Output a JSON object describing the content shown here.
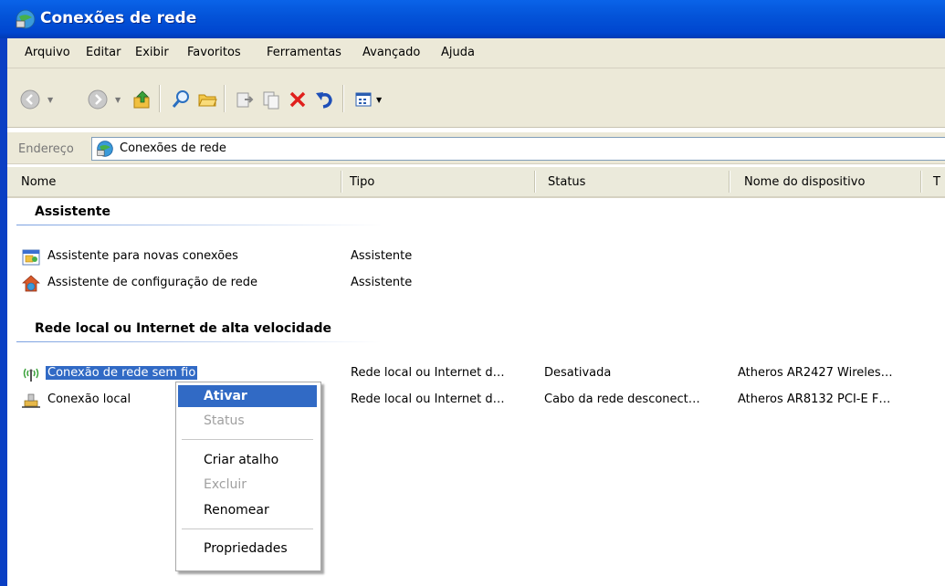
{
  "window": {
    "title": "Conexões de rede"
  },
  "menu": [
    "Arquivo",
    "Editar",
    "Exibir",
    "Favoritos",
    "Ferramentas",
    "Avançado",
    "Ajuda"
  ],
  "toolbar": {
    "icons": [
      "back-icon",
      "forward-icon",
      "up-folder-icon",
      "search-icon",
      "folders-icon",
      "move-to-icon",
      "copy-to-icon",
      "delete-icon",
      "undo-icon",
      "views-icon"
    ]
  },
  "address": {
    "label": "Endereço",
    "value": "Conexões de rede"
  },
  "columns": [
    "Nome",
    "Tipo",
    "Status",
    "Nome do dispositivo",
    "T"
  ],
  "groups": [
    {
      "title": "Assistente",
      "items": [
        {
          "name": "Assistente para novas conexões",
          "tipo": "Assistente",
          "status": "",
          "device": ""
        },
        {
          "name": "Assistente de configuração de rede",
          "tipo": "Assistente",
          "status": "",
          "device": ""
        }
      ]
    },
    {
      "title": "Rede local ou Internet de alta velocidade",
      "items": [
        {
          "name": "Conexão de rede sem fio",
          "tipo": "Rede local ou Internet d…",
          "status": "Desativada",
          "device": "Atheros AR2427 Wireles…"
        },
        {
          "name": "Conexão local",
          "tipo": "Rede local ou Internet d…",
          "status": "Cabo da rede desconect…",
          "device": "Atheros AR8132 PCI-E F…"
        }
      ]
    }
  ],
  "context_menu": {
    "items": [
      {
        "label": "Ativar",
        "state": "highlighted"
      },
      {
        "label": "Status",
        "state": "disabled"
      },
      {
        "label": "Criar atalho",
        "state": "enabled"
      },
      {
        "label": "Excluir",
        "state": "disabled"
      },
      {
        "label": "Renomear",
        "state": "enabled"
      },
      {
        "label": "Propriedades",
        "state": "enabled"
      }
    ]
  },
  "colors": {
    "titlebar": "#0454d9",
    "selection": "#316ac5",
    "chrome": "#ece9d8"
  }
}
